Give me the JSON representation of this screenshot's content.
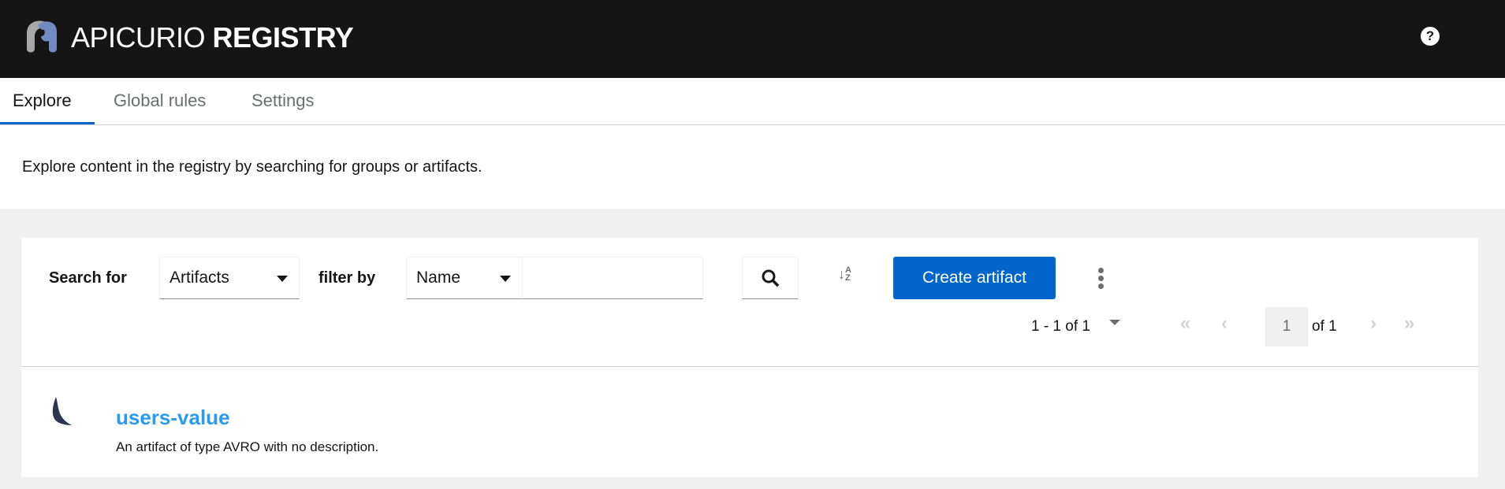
{
  "header": {
    "brand_light": "APICURIO",
    "brand_bold": "REGISTRY",
    "help_icon": "?"
  },
  "tabs": [
    {
      "label": "Explore",
      "active": true
    },
    {
      "label": "Global rules"
    },
    {
      "label": "Settings"
    }
  ],
  "description": "Explore content in the registry by searching for groups or artifacts.",
  "toolbar": {
    "search_for_label": "Search for",
    "search_type": "Artifacts",
    "filter_by_label": "filter by",
    "filter_type": "Name",
    "search_value": "",
    "create_label": "Create artifact"
  },
  "pagination": {
    "range": "1 - 1 of 1",
    "page": "1",
    "of_pages": "of 1"
  },
  "artifacts": [
    {
      "name": "users-value",
      "description": "An artifact of type AVRO with no description."
    }
  ],
  "colors": {
    "accent": "#0066cc",
    "link": "#2b9af3",
    "header": "#151515"
  }
}
